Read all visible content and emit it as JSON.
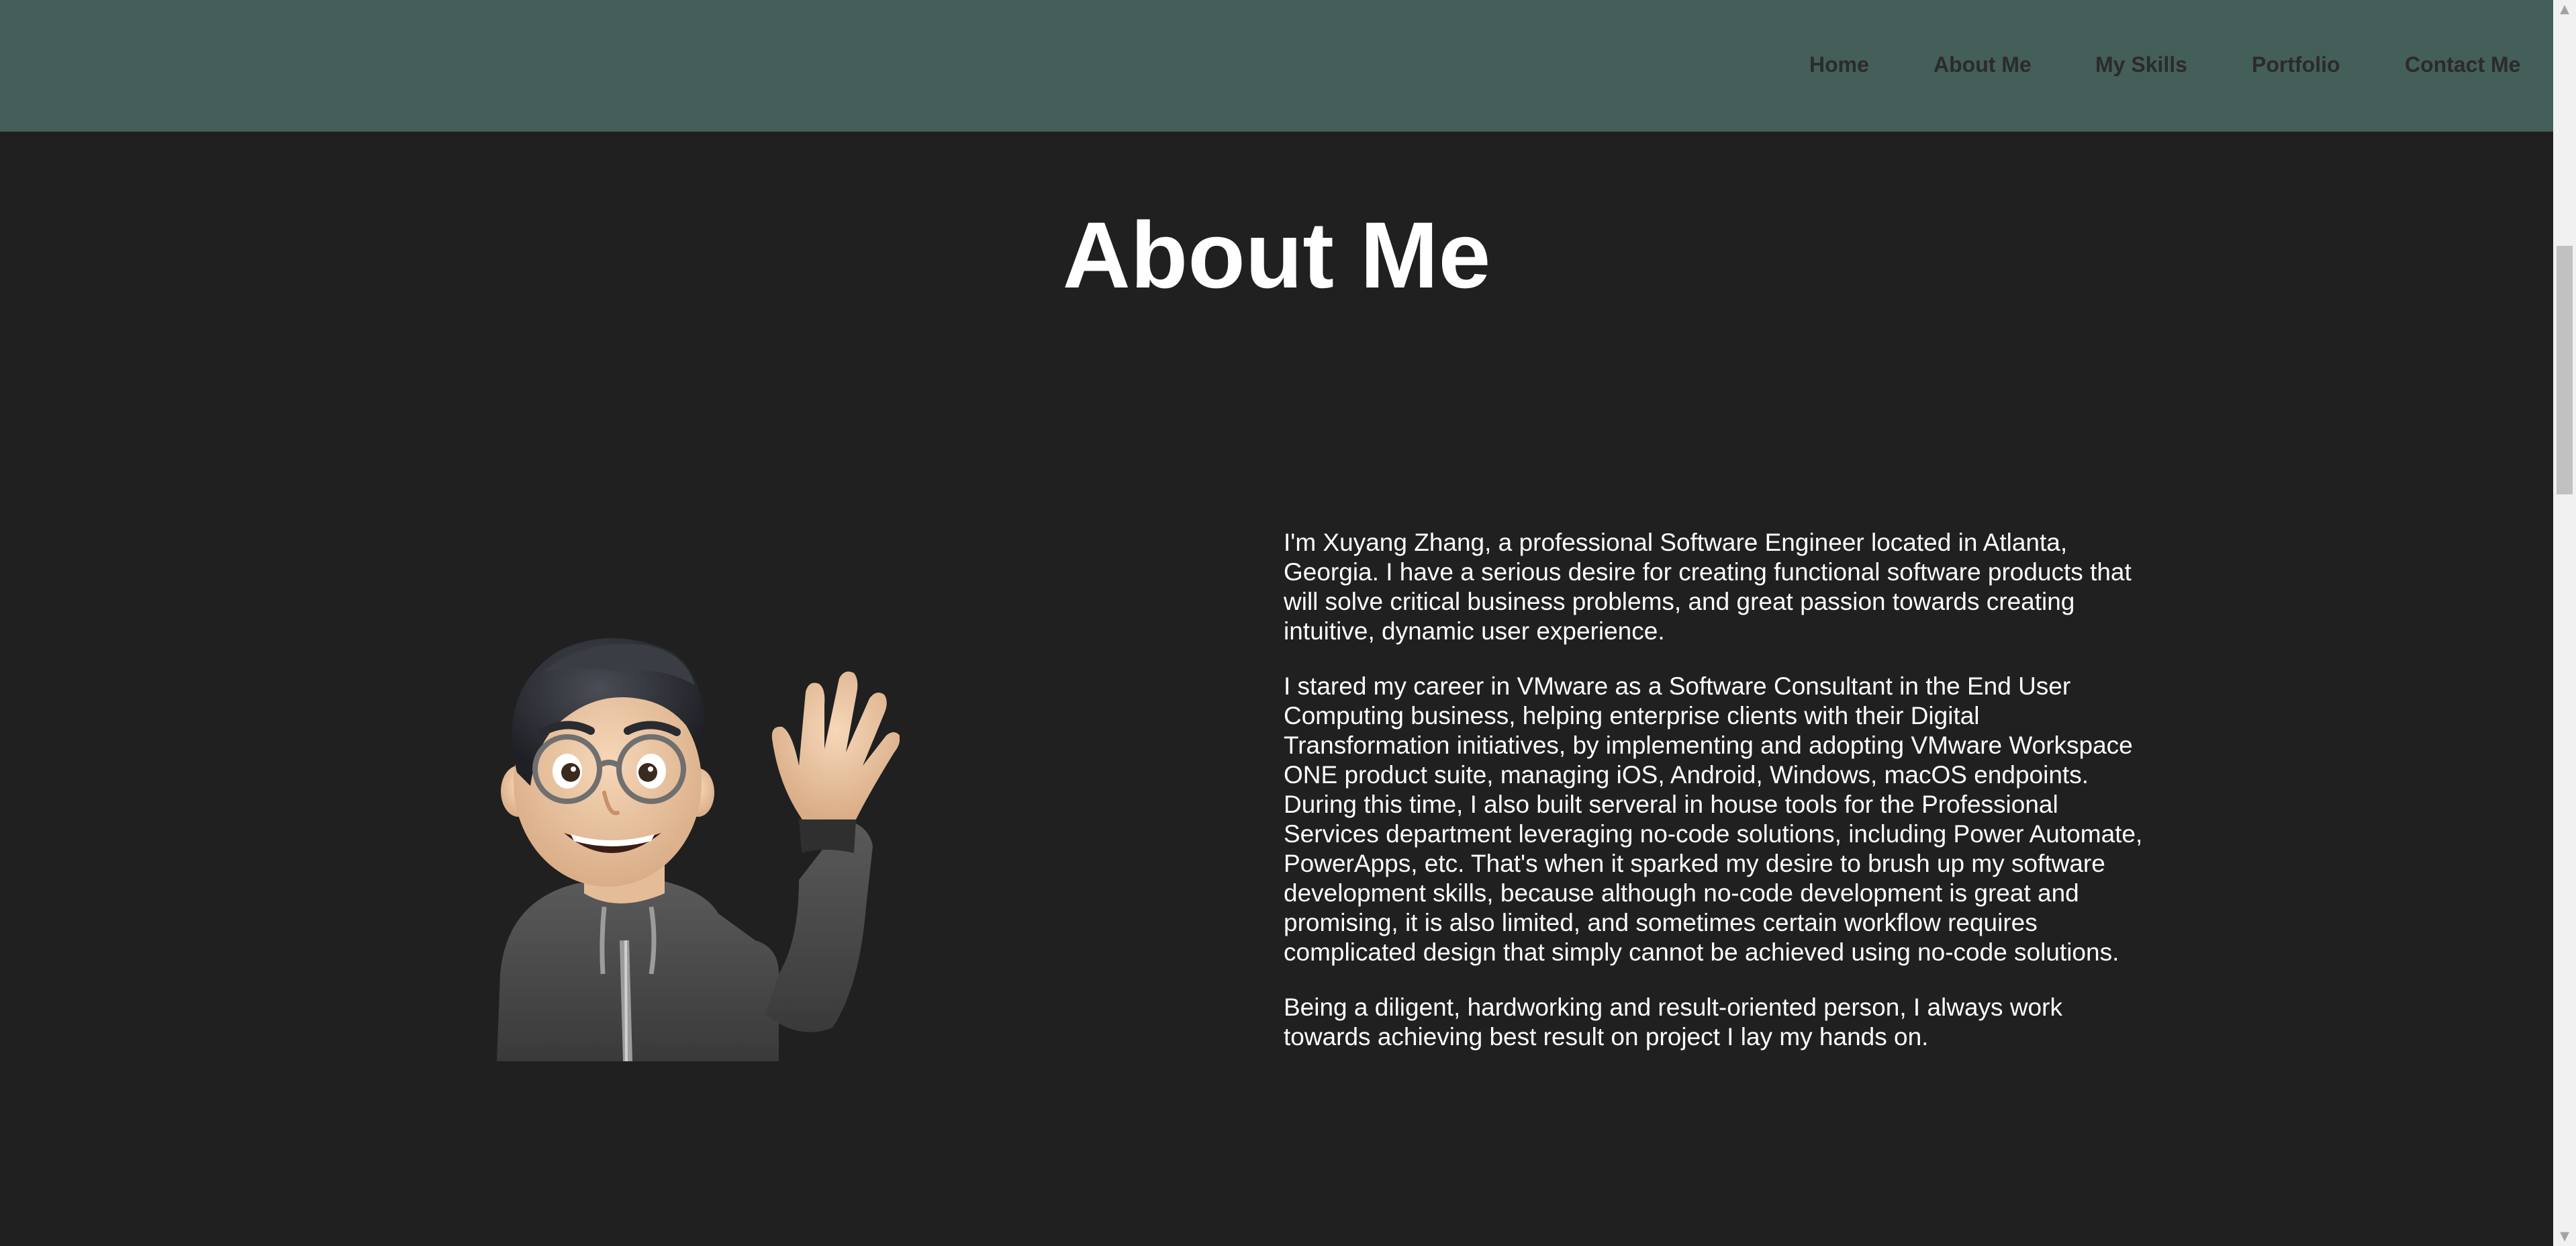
{
  "nav": {
    "items": [
      {
        "label": "Home"
      },
      {
        "label": "About Me"
      },
      {
        "label": "My Skills"
      },
      {
        "label": "Portfolio"
      },
      {
        "label": "Contact Me"
      }
    ]
  },
  "about": {
    "title": "About Me",
    "paragraphs": [
      "I'm Xuyang Zhang, a professional Software Engineer located in Atlanta, Georgia. I have a serious desire for creating functional software products that will solve critical business problems, and great passion towards creating intuitive, dynamic user experience.",
      "I stared my career in VMware as a Software Consultant in the End User Computing business, helping enterprise clients with their Digital Transformation initiatives, by implementing and adopting VMware Workspace ONE product suite, managing iOS, Android, Windows, macOS endpoints. During this time, I also built serveral in house tools for the Professional Services department leveraging no-code solutions, including Power Automate, PowerApps, etc. That's when it sparked my desire to brush up my software development skills, because although no-code development is great and promising, it is also limited, and sometimes certain workflow requires complicated design that simply cannot be achieved using no-code solutions.",
      "Being a diligent, hardworking and result-oriented person, I always work towards achieving best result on project I lay my hands on."
    ]
  },
  "colors": {
    "navbar_bg": "#445e59",
    "page_bg": "#202020",
    "nav_text": "#2b2b2b",
    "text": "#ffffff"
  },
  "icons": {
    "avatar": "waving-memoji-avatar",
    "scroll_up": "triangle-up-icon",
    "scroll_down": "triangle-down-icon"
  }
}
